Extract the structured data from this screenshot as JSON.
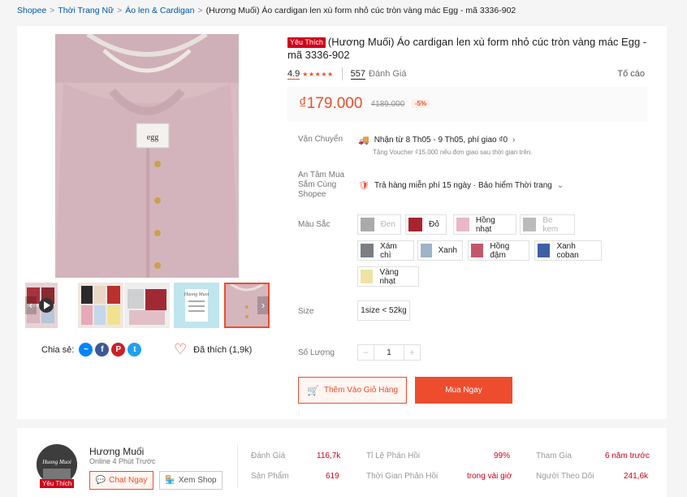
{
  "breadcrumb": {
    "items": [
      "Shopee",
      "Thời Trang Nữ",
      "Áo len & Cardigan"
    ],
    "current": "(Hương Muối) Áo cardigan len xù form nhỏ cúc tròn vàng mác Egg - mã 3336-902"
  },
  "gallery": {
    "main_label": "egg",
    "thumb_caption": "Huong Muoi"
  },
  "share": {
    "label": "Chia sẻ:",
    "icons": [
      "messenger-icon",
      "facebook-icon",
      "pinterest-icon",
      "twitter-icon"
    ]
  },
  "like": {
    "label": "Đã thích (1,9k)"
  },
  "product": {
    "badge": "Yêu Thích",
    "title": "(Hương Muối) Áo cardigan len xù form nhỏ cúc tròn vàng mác Egg - mã 3336-902",
    "rating": "4.9",
    "stars": "★★★★★",
    "review_count": "557",
    "review_label": "Đánh Giá",
    "report": "Tố cáo"
  },
  "price": {
    "current": "₫179.000",
    "original": "₫189.000",
    "discount": "-5%"
  },
  "shipping": {
    "label": "Vận Chuyển",
    "main": "Nhận từ 8 Th05 - 9 Th05, phí giao ₫0",
    "sub": "Tặng Voucher ₫15.000 nếu đơn giao sau thời gian trên."
  },
  "assurance": {
    "label_lines": [
      "An Tâm Mua",
      "Sắm Cùng",
      "Shopee"
    ],
    "text": "Trả hàng miễn phí 15 ngày · Bảo hiểm Thời trang"
  },
  "colors": {
    "label": "Màu Sắc",
    "options": [
      "Đen",
      "Đỏ",
      "Hồng nhạt",
      "Be kem",
      "Xám chì",
      "Xanh",
      "Hồng đậm",
      "Xanh coban",
      "Vàng nhạt"
    ]
  },
  "size": {
    "label": "Size",
    "option": "1size < 52kg"
  },
  "quantity": {
    "label": "Số Lượng",
    "value": "1",
    "minus": "−",
    "plus": "+"
  },
  "actions": {
    "add_to_cart": "Thêm Vào Giỏ Hàng",
    "buy_now": "Mua Ngay"
  },
  "shop": {
    "name": "Hương Muối",
    "status": "Online 4 Phút Trước",
    "badge": "Yêu Thích",
    "chat": "Chat Ngay",
    "view": "Xem Shop",
    "stats": {
      "ratings_label": "Đánh Giá",
      "ratings_value": "116,7k",
      "products_label": "Sản Phẩm",
      "products_value": "619",
      "response_rate_label": "Tỉ Lệ Phản Hồi",
      "response_rate_value": "99%",
      "response_time_label": "Thời Gian Phản Hồi",
      "response_time_value": "trong vài giờ",
      "joined_label": "Tham Gia",
      "joined_value": "6 năm trước",
      "followers_label": "Người Theo Dõi",
      "followers_value": "241,6k"
    }
  },
  "colors_theme": {
    "accent": "#ee4d2d",
    "badge": "#d0011b"
  }
}
